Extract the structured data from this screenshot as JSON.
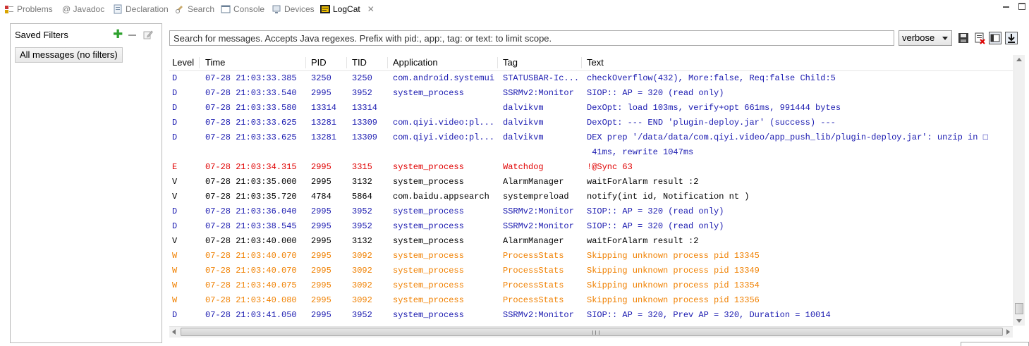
{
  "tabs": [
    {
      "label": "Problems",
      "icon": "problems-icon"
    },
    {
      "label": "@ Javadoc",
      "icon": "javadoc-icon"
    },
    {
      "label": "Declaration",
      "icon": "declaration-icon"
    },
    {
      "label": "Search",
      "icon": "search-icon"
    },
    {
      "label": "Console",
      "icon": "console-icon"
    },
    {
      "label": "Devices",
      "icon": "devices-icon"
    },
    {
      "label": "LogCat",
      "icon": "logcat-icon",
      "active": true
    }
  ],
  "filters": {
    "title": "Saved Filters",
    "items": [
      "All messages (no filters)"
    ]
  },
  "search": {
    "placeholder": "Search for messages. Accepts Java regexes. Prefix with pid:, app:, tag: or text: to limit scope."
  },
  "level_select": {
    "value": "verbose"
  },
  "columns": [
    "Level",
    "Time",
    "PID",
    "TID",
    "Application",
    "Tag",
    "Text"
  ],
  "level_colors": {
    "D": "#1a1ab0",
    "E": "#e00000",
    "V": "#000000",
    "W": "#f08000"
  },
  "rows": [
    {
      "level": "D",
      "time": "07-28 21:03:33.385",
      "pid": "3250",
      "tid": "3250",
      "app": "com.android.systemui",
      "tag": "STATUSBAR-Ic...",
      "text": "checkOverflow(432), More:false, Req:false Child:5"
    },
    {
      "level": "D",
      "time": "07-28 21:03:33.540",
      "pid": "2995",
      "tid": "3952",
      "app": "system_process",
      "tag": "SSRMv2:Monitor",
      "text": "SIOP:: AP = 320 (read only)"
    },
    {
      "level": "D",
      "time": "07-28 21:03:33.580",
      "pid": "13314",
      "tid": "13314",
      "app": "",
      "tag": "dalvikvm",
      "text": "DexOpt: load 103ms, verify+opt 661ms, 991444 bytes"
    },
    {
      "level": "D",
      "time": "07-28 21:03:33.625",
      "pid": "13281",
      "tid": "13309",
      "app": "com.qiyi.video:pl...",
      "tag": "dalvikvm",
      "text": "DexOpt: --- END 'plugin-deploy.jar' (success) ---"
    },
    {
      "level": "D",
      "time": "07-28 21:03:33.625",
      "pid": "13281",
      "tid": "13309",
      "app": "com.qiyi.video:pl...",
      "tag": "dalvikvm",
      "text": "DEX prep '/data/data/com.qiyi.video/app_push_lib/plugin-deploy.jar': unzip in □\n 41ms, rewrite 1047ms"
    },
    {
      "level": "E",
      "time": "07-28 21:03:34.315",
      "pid": "2995",
      "tid": "3315",
      "app": "system_process",
      "tag": "Watchdog",
      "text": "!@Sync 63"
    },
    {
      "level": "V",
      "time": "07-28 21:03:35.000",
      "pid": "2995",
      "tid": "3132",
      "app": "system_process",
      "tag": "AlarmManager",
      "text": "waitForAlarm result :2"
    },
    {
      "level": "V",
      "time": "07-28 21:03:35.720",
      "pid": "4784",
      "tid": "5864",
      "app": "com.baidu.appsearch",
      "tag": "systempreload",
      "text": "notify(int id, Notification nt )"
    },
    {
      "level": "D",
      "time": "07-28 21:03:36.040",
      "pid": "2995",
      "tid": "3952",
      "app": "system_process",
      "tag": "SSRMv2:Monitor",
      "text": "SIOP:: AP = 320 (read only)"
    },
    {
      "level": "D",
      "time": "07-28 21:03:38.545",
      "pid": "2995",
      "tid": "3952",
      "app": "system_process",
      "tag": "SSRMv2:Monitor",
      "text": "SIOP:: AP = 320 (read only)"
    },
    {
      "level": "V",
      "time": "07-28 21:03:40.000",
      "pid": "2995",
      "tid": "3132",
      "app": "system_process",
      "tag": "AlarmManager",
      "text": "waitForAlarm result :2"
    },
    {
      "level": "W",
      "time": "07-28 21:03:40.070",
      "pid": "2995",
      "tid": "3092",
      "app": "system_process",
      "tag": "ProcessStats",
      "text": "Skipping unknown process pid 13345"
    },
    {
      "level": "W",
      "time": "07-28 21:03:40.070",
      "pid": "2995",
      "tid": "3092",
      "app": "system_process",
      "tag": "ProcessStats",
      "text": "Skipping unknown process pid 13349"
    },
    {
      "level": "W",
      "time": "07-28 21:03:40.075",
      "pid": "2995",
      "tid": "3092",
      "app": "system_process",
      "tag": "ProcessStats",
      "text": "Skipping unknown process pid 13354"
    },
    {
      "level": "W",
      "time": "07-28 21:03:40.080",
      "pid": "2995",
      "tid": "3092",
      "app": "system_process",
      "tag": "ProcessStats",
      "text": "Skipping unknown process pid 13356"
    },
    {
      "level": "D",
      "time": "07-28 21:03:41.050",
      "pid": "2995",
      "tid": "3952",
      "app": "system_process",
      "tag": "SSRMv2:Monitor",
      "text": "SIOP:: AP = 320, Prev AP = 320, Duration = 10014"
    }
  ]
}
